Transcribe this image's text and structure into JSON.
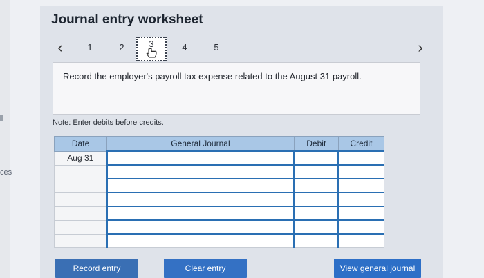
{
  "page": {
    "title": "Journal entry worksheet",
    "left_fragment": "ces"
  },
  "nav": {
    "prev_icon": "chevron-left-icon",
    "next_icon": "chevron-right-icon",
    "pages": [
      "1",
      "2",
      "3",
      "4",
      "5"
    ],
    "active_page": "3"
  },
  "prompt": {
    "text": "Record the employer's payroll tax expense related to the August 31 payroll."
  },
  "note": "Note: Enter debits before credits.",
  "table": {
    "headers": {
      "date": "Date",
      "general_journal": "General Journal",
      "debit": "Debit",
      "credit": "Credit"
    },
    "rows": [
      {
        "date": "Aug 31",
        "general_journal": "",
        "debit": "",
        "credit": ""
      },
      {
        "date": "",
        "general_journal": "",
        "debit": "",
        "credit": ""
      },
      {
        "date": "",
        "general_journal": "",
        "debit": "",
        "credit": ""
      },
      {
        "date": "",
        "general_journal": "",
        "debit": "",
        "credit": ""
      },
      {
        "date": "",
        "general_journal": "",
        "debit": "",
        "credit": ""
      },
      {
        "date": "",
        "general_journal": "",
        "debit": "",
        "credit": ""
      },
      {
        "date": "",
        "general_journal": "",
        "debit": "",
        "credit": ""
      }
    ]
  },
  "buttons": {
    "record": "Record entry",
    "clear": "Clear entry",
    "view": "View general journal"
  },
  "colors": {
    "header_bg": "#a9c7e6",
    "button_bg": "#2f6fbf",
    "input_border": "#2a6fb3"
  }
}
